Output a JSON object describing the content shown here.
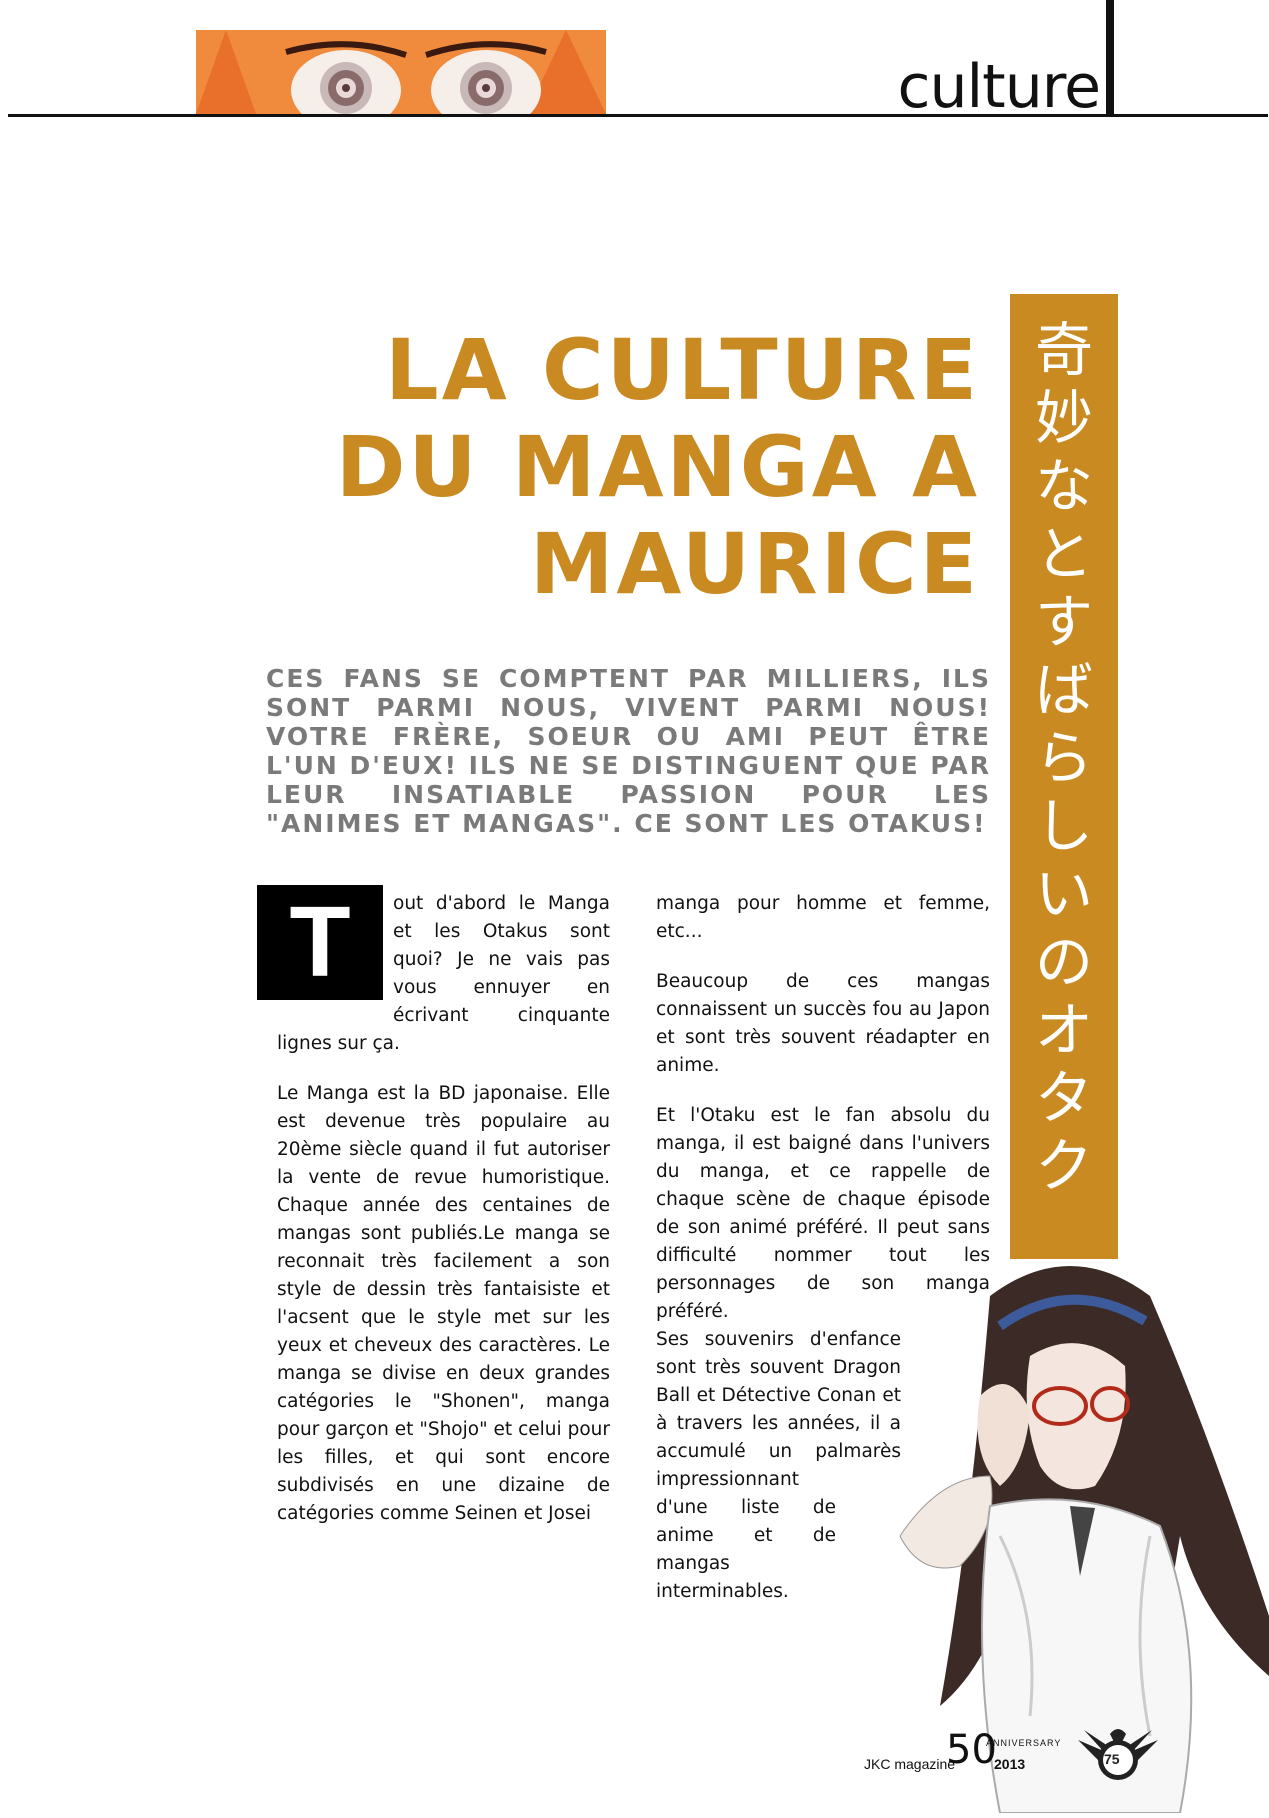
{
  "header": {
    "section_label": "culture"
  },
  "sidebar": {
    "japanese_text": "奇妙なとすばらしいのオタク"
  },
  "article": {
    "title": "LA CULTURE DU MANGA A MAURICE",
    "intro": "Ces fans se comptent par milliers, ils sont parmi nous, vivent parmi nous! Votre frère, soeur ou ami peut être l'un d'eux! Ils ne se distinguent que par leur insatiable passion pour les \"animes et mangas\". Ce sont les Otakus!",
    "dropcap": "T",
    "col1_p1": "out d'abord le Manga et les Otakus sont quoi? Je ne vais pas vous ennuyer en écrivant cinquante lignes sur ça.",
    "col1_p2": "Le Manga est la BD japonaise. Elle est devenue très  populaire au 20ème siècle quand il fut autoriser la vente de revue humoristique. Chaque année des centaines de mangas sont publiés.Le manga se reconnait très facilement a son style de dessin très fantaisiste et l'acsent que le style met sur les yeux et cheveux des caractères. Le manga se divise en deux grandes catégories le \"Shonen\", manga pour garçon et \"Shojo\" et celui pour les filles, et qui sont encore subdivisés en une dizaine de catégories comme Seinen et Josei",
    "col2_p1": "manga pour homme et femme, etc...",
    "col2_p2": "Beaucoup de ces mangas connaissent un succès fou au Japon et sont très souvent réadapter en anime.",
    "col2_p3a": "Et  l'Otaku est le fan absolu du manga, il est baigné dans l'univers du manga, et ce rappelle de chaque scène de chaque épisode de son animé préféré. Il peut sans difficulté nommer tout les personnages de son manga préféré.",
    "col2_p3b": "Ses souvenirs d'enfance sont très souvent Dragon Ball et Détective Conan et à travers les années, il a accumulé un palmarès impressionnant",
    "col2_p3c": "d'une liste de anime et de mangas interminables."
  },
  "footer": {
    "magazine": "JKC magazine",
    "fifty": "50",
    "anniversary": "ANNIVERSARY",
    "year": "2013",
    "crest_number": "75"
  },
  "colors": {
    "accent": "#c98a22",
    "intro_gray": "#7a7a7a"
  },
  "icons": [
    "manga-eyes-header-art",
    "manga-girl-illustration",
    "school-crest-icon"
  ]
}
